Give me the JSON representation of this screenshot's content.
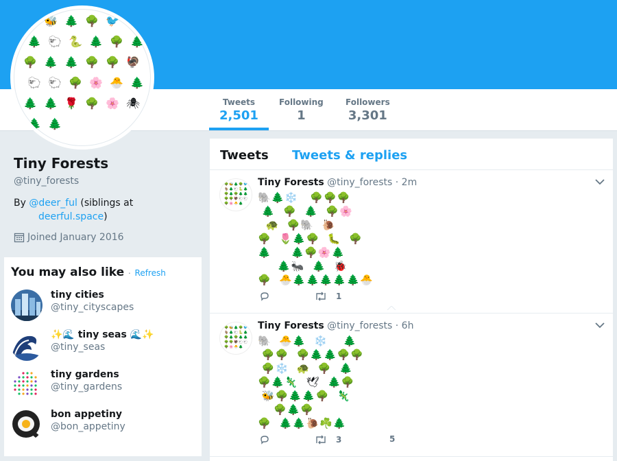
{
  "nav": {
    "stats": [
      {
        "label": "Tweets",
        "value": "2,501",
        "active": true
      },
      {
        "label": "Following",
        "value": "1",
        "active": false
      },
      {
        "label": "Followers",
        "value": "3,301",
        "active": false
      }
    ]
  },
  "avatar": {
    "glyphs": [
      "🌳",
      "🐝",
      "🌲",
      "🌳",
      "🐦",
      "🐐",
      "🌲",
      "🐑",
      "🐍",
      "🌲",
      "🌳",
      "🌲",
      "🌳",
      "🌲",
      "🌲",
      "🌳",
      "🌳",
      "🦃",
      "🐑",
      "🐑",
      "🌳",
      "🌸",
      "🐣",
      "🌲",
      "🌲",
      "🌲",
      "🌹",
      "🌳",
      "🌸",
      "🕷",
      "🌲",
      "🌲"
    ]
  },
  "profile": {
    "name": "Tiny Forests",
    "handle": "@tiny_forests",
    "bio_prefix": "By ",
    "bio_link": "@deer_ful",
    "bio_middle": " (siblings at",
    "bio_link2": "deerful.space",
    "bio_suffix": ")",
    "joined": "Joined January 2016"
  },
  "suggestions": {
    "heading": "You may also like",
    "dot": "·",
    "refresh": "Refresh",
    "items": [
      {
        "name": "tiny cities",
        "handle": "@tiny_cityscapes"
      },
      {
        "name": "✨🌊 tiny seas 🌊✨",
        "handle": "@tiny_seas"
      },
      {
        "name": "tiny gardens",
        "handle": "@tiny_gardens"
      },
      {
        "name": "bon appetiny",
        "handle": "@bon_appetiny"
      }
    ]
  },
  "timeline": {
    "tabs": [
      "Tweets",
      "Tweets & replies"
    ],
    "tweets": [
      {
        "name": "Tiny Forests",
        "handle": "@tiny_forests",
        "time": "· 2m",
        "rows": [
          "🐘🌲❄️   🌳🌳🌳",
          " 🌲  🌳  🌲  🌳🌸",
          "  🐢  🌳🐘  🐌",
          "🌳  🌷🌲🌳  🐛  🌳",
          "🌲     🌲🌳🌸🌲",
          "     🌲🐜  🌲  🐞",
          "🌳  🐣🌲🌲🌲🌲🌲🐣"
        ],
        "replies": "",
        "retweets": "1",
        "likes": ""
      },
      {
        "name": "Tiny Forests",
        "handle": "@tiny_forests",
        "time": "· 6h",
        "rows": [
          "🐘  🐣🌲  ❄️    🌲",
          " 🌳🌳  🌳🌲🌲🌳🌳",
          " 🌳❄️  🐢  🌳  🌲",
          "🌳🌲🦎  🕊  🌲🌳",
          " 🐝🌳🌲🌲🌳  🦎",
          "    🌳🌲🌳",
          "🌳  🌲🌲🐌☘️🌲"
        ],
        "replies": "",
        "retweets": "3",
        "likes": "5"
      }
    ]
  },
  "colors": {
    "accent": "#1da1f2",
    "muted": "#657786",
    "background": "#e6ecf0"
  }
}
